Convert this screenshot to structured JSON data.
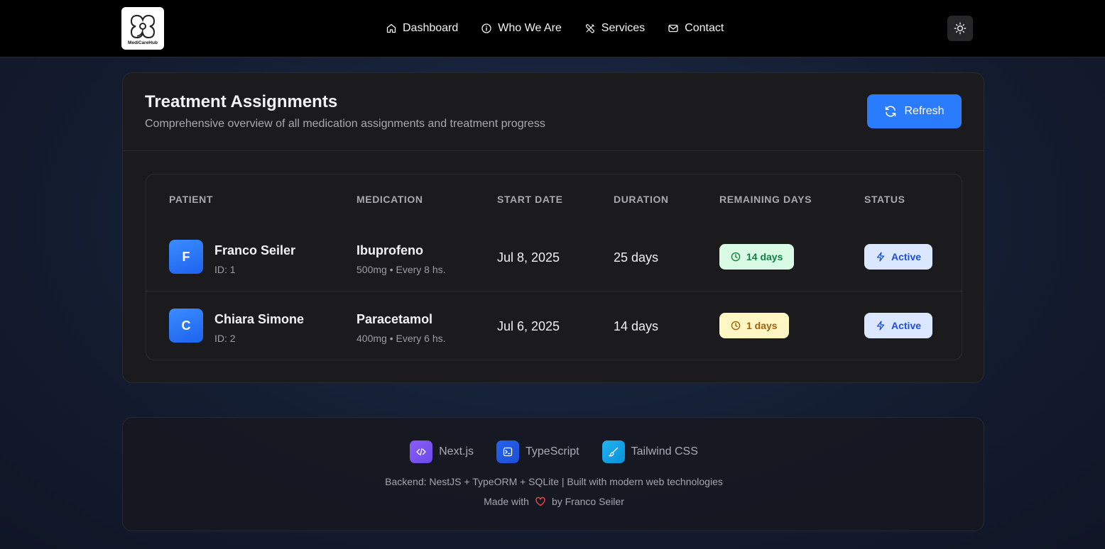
{
  "nav": {
    "logo_text": "MediCareHub",
    "links": [
      {
        "label": "Dashboard",
        "icon": "home-icon"
      },
      {
        "label": "Who We Are",
        "icon": "info-icon"
      },
      {
        "label": "Services",
        "icon": "tools-icon"
      },
      {
        "label": "Contact",
        "icon": "mail-icon"
      }
    ],
    "theme_toggle_icon": "sun-icon"
  },
  "card": {
    "title": "Treatment Assignments",
    "subtitle": "Comprehensive overview of all medication assignments and treatment progress",
    "refresh_label": "Refresh"
  },
  "table": {
    "headers": [
      "Patient",
      "Medication",
      "Start Date",
      "Duration",
      "Remaining Days",
      "Status"
    ],
    "rows": [
      {
        "initial": "F",
        "patient": "Franco Seiler",
        "patient_id": "ID: 1",
        "medication": "Ibuprofeno",
        "dose": "500mg • Every 8 hs.",
        "start_date": "Jul 8, 2025",
        "duration": "25 days",
        "remaining": "14 days",
        "remaining_color": "#15803d",
        "status": "Active"
      },
      {
        "initial": "C",
        "patient": "Chiara Simone",
        "patient_id": "ID: 2",
        "medication": "Paracetamol",
        "dose": "400mg • Every 6 hs.",
        "start_date": "Jul 6, 2025",
        "duration": "14 days",
        "remaining": "1 days",
        "remaining_color": "#a16207",
        "status": "Active"
      }
    ]
  },
  "footer": {
    "techs": [
      {
        "label": "Next.js",
        "icon": "code-icon"
      },
      {
        "label": "TypeScript",
        "icon": "terminal-icon"
      },
      {
        "label": "Tailwind CSS",
        "icon": "brush-icon"
      }
    ],
    "backend_line": "Backend: NestJS + TypeORM + SQLite | Built with modern web technologies",
    "made_with": "Made with",
    "by_line": "by Franco Seiler"
  },
  "colors": {
    "accent": "#2b7bff",
    "active_badge_bg": "#dbe7ff",
    "heart": "#ef4444"
  }
}
